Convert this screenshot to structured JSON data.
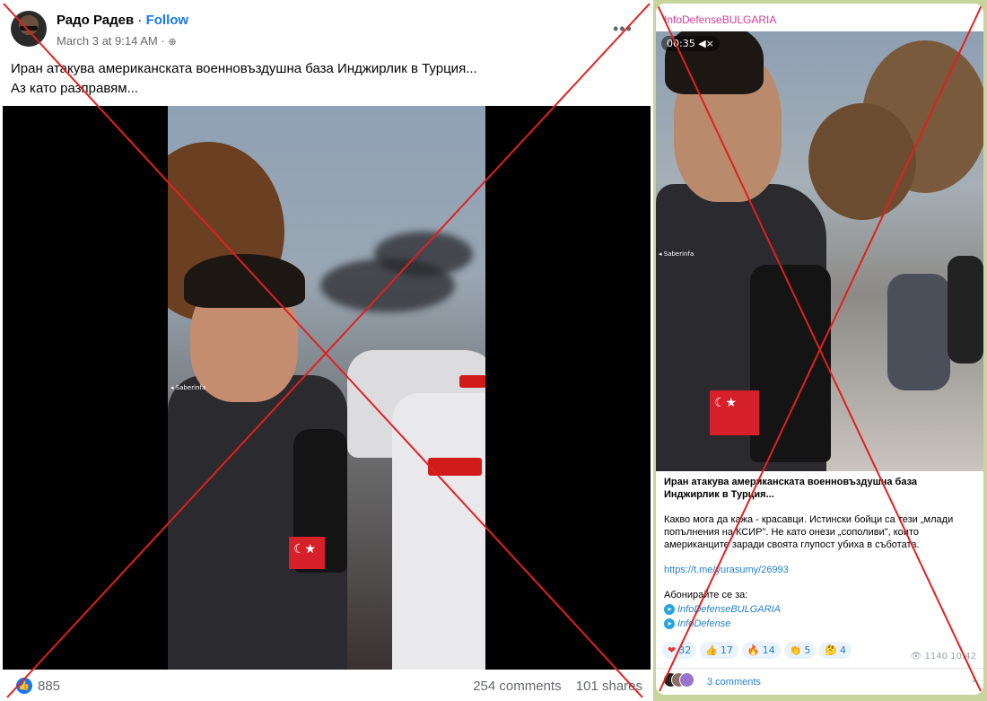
{
  "facebook_post": {
    "author": "Радо Радев",
    "follow_label": "Follow",
    "separator": "·",
    "timestamp": "March 3 at 9:14 AM",
    "audience_icon": "globe-icon",
    "more_icon": "more-options-icon",
    "caption_line1": "Иран атакува американската военновъздушна база Инджирлик в Турция...",
    "caption_line2": "Аз като разправям...",
    "video_watermark": "Saberinfa",
    "reaction_count": "885",
    "comments": "254 comments",
    "shares": "101 shares"
  },
  "telegram_post": {
    "channel": "InfoDefenseBULGARIA",
    "video_time": "00:35",
    "video_watermark": "Saberinfa",
    "title": "Иран атакува американската военновъздушна база Инджирлик в Турция...",
    "paragraph": "Какво мога да кажа - красавци. Истински бойци са тези „млади попълнения на КСИР\". Не като онези „сополиви\", които американците заради своята глупост убиха в съботата.",
    "link": "https://t.me/yurasumy/26993",
    "subscribe_label": "Абонирайте се за:",
    "sub_links": [
      "InfoDefenseBULGARIA",
      "InfoDefense"
    ],
    "reactions": [
      {
        "emoji": "❤",
        "count": "32"
      },
      {
        "emoji": "👍",
        "count": "17"
      },
      {
        "emoji": "🔥",
        "count": "14"
      },
      {
        "emoji": "👏",
        "count": "5"
      },
      {
        "emoji": "🤔",
        "count": "4"
      }
    ],
    "views": "1140",
    "time": "10:42",
    "comments_label": "3 comments"
  },
  "colors": {
    "facebook_blue": "#1877f2",
    "telegram_link": "#2481cc",
    "channel_name": "#d43b9b",
    "telegram_bg": "#c7d49c",
    "cross": "#e02020"
  }
}
